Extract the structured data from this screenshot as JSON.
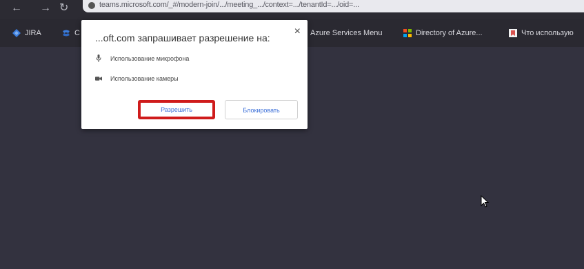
{
  "browser": {
    "url": "teams.microsoft.com/_#/modern-join/.../meeting_.../context=.../tenantId=.../oid=..."
  },
  "bookmarks": [
    {
      "label": "JIRA",
      "icon": "jira-icon",
      "color": "#3b7ddd"
    },
    {
      "label": "C",
      "icon": "confluence-icon",
      "color": "#3b7ddd"
    },
    {
      "label": "Azure Services Menu",
      "icon": "",
      "color": ""
    },
    {
      "label": "Directory of Azure...",
      "icon": "azure-icon",
      "color": "#f4b400"
    },
    {
      "label": "Что использую",
      "icon": "bookmark-icon",
      "color": "#d9534f"
    }
  ],
  "permission_popup": {
    "title": "...oft.com запрашивает разрешение на:",
    "close_symbol": "×",
    "items": [
      {
        "label": "Использование микрофона",
        "icon": "microphone-icon"
      },
      {
        "label": "Использование камеры",
        "icon": "camera-icon"
      }
    ],
    "allow_label": "Разрешить",
    "block_label": "Блокировать"
  },
  "colors": {
    "highlight": "#cf1b1b",
    "link": "#3b6fd8",
    "background": "#33323f"
  }
}
